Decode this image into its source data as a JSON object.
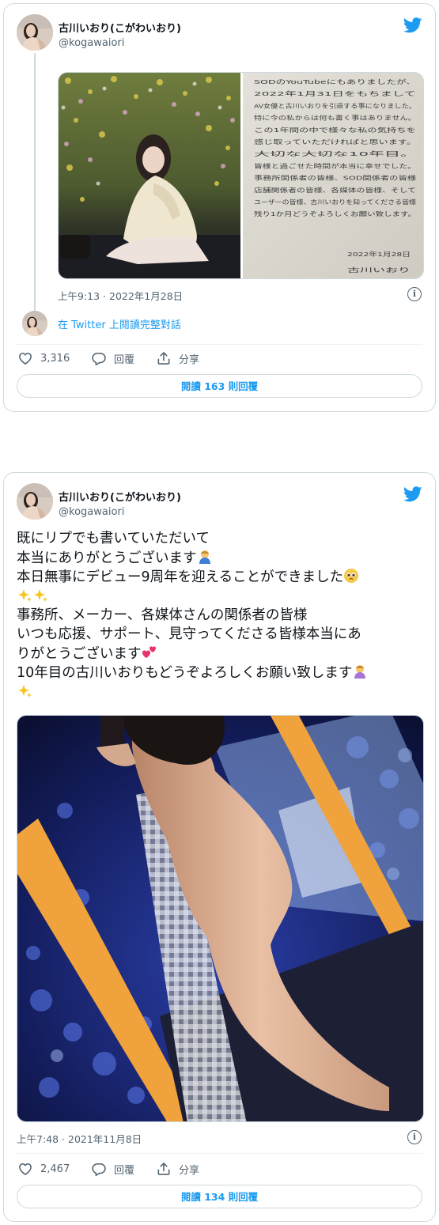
{
  "tweet1": {
    "author_name": "古川いおり(こがわいおり)",
    "handle": "@kogawaiori",
    "handwritten_note_lines": [
      "SODのYouTubeにもありましたが、",
      "2022年1月31日をもちまして",
      "AV女優と古川いおりを引退する事になりました。",
      "特に今の私からは何も書く事はありません。",
      "この1年間の中で様々な私の気持ちを",
      "感じ取っていただければと思います。",
      "大切な大切な10年目。",
      "皆様と過ごせた時間が本当に幸せでした。",
      "事務所関係者の皆様、SOD関係者の皆様",
      "店舗関係者の皆様、各媒体の皆様、そして",
      "ユーザーの皆様、古川いおりを知ってくださる皆様",
      "残り1か月どうぞよろしくお願い致します。",
      "2022年1月28日",
      "古川いおり"
    ],
    "timestamp": "上午9:13 · 2022年1月28日",
    "thread_link": "在 Twitter 上閱讀完整對話",
    "like_count": "3,316",
    "reply_label": "回覆",
    "share_label": "分享",
    "read_replies": {
      "prefix": "閱讀 ",
      "count": "163",
      "suffix": " 則回覆"
    }
  },
  "tweet2": {
    "author_name": "古川いおり(こがわいおり)",
    "handle": "@kogawaiori",
    "text_lines": [
      "既にリプでも書いていただいて",
      "本当にありがとうございます",
      "本日無事にデビュー9周年を迎えることができました",
      "",
      "事務所、メーカー、各媒体さんの関係者の皆様",
      "いつも応援、サポート、見守ってくださる皆様本当にあ",
      "りがとうございます",
      "10年目の古川いおりもどうぞよろしくお願い致します",
      ""
    ],
    "timestamp": "上午7:48 · 2021年11月8日",
    "like_count": "2,467",
    "reply_label": "回覆",
    "share_label": "分享",
    "read_replies": {
      "prefix": "閱讀 ",
      "count": "134",
      "suffix": " 則回覆"
    }
  },
  "icons": {
    "brand": "twitter-bird-icon",
    "like": "heart-icon",
    "reply": "speech-bubble-icon",
    "share": "share-upload-icon",
    "info": "info-icon"
  },
  "colors": {
    "brand": "#1d9bf0",
    "text": "#0f1419",
    "secondary": "#536471",
    "border": "#cfd9de"
  }
}
